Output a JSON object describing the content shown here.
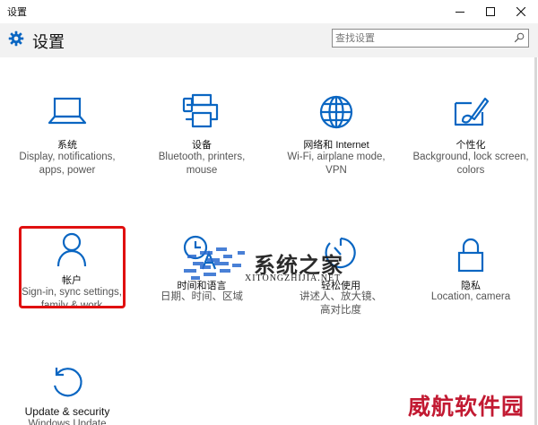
{
  "window": {
    "title": "设置",
    "controls": {
      "minimize_icon": "minimize-icon",
      "maximize_icon": "maximize-icon",
      "close_icon": "close-icon"
    }
  },
  "header": {
    "icon": "gear-icon",
    "title": "设置",
    "search": {
      "placeholder": "查找设置",
      "value": "",
      "icon": "search-icon"
    }
  },
  "tiles": [
    {
      "icon": "laptop-icon",
      "name": "系统",
      "desc": "Display, notifications, apps, power"
    },
    {
      "icon": "printer-icon",
      "name": "设备",
      "desc": "Bluetooth, printers, mouse"
    },
    {
      "icon": "globe-icon",
      "name": "网络和 Internet",
      "desc": "Wi-Fi, airplane mode, VPN"
    },
    {
      "icon": "paintbrush-icon",
      "name": "个性化",
      "desc": "Background, lock screen, colors"
    },
    {
      "icon": "person-icon",
      "name": "帐户",
      "desc": "Sign-in, sync settings, family & work",
      "highlighted": true
    },
    {
      "icon": "clock-language-icon",
      "name": "时间和语言",
      "desc": "日期、时间、区域"
    },
    {
      "icon": "accessibility-timer-icon",
      "name": "轻松使用",
      "desc": "讲述人、放大镜、高对比度"
    },
    {
      "icon": "lock-icon",
      "name": "隐私",
      "desc": "Location, camera"
    },
    {
      "icon": "update-icon",
      "name": "Update & security",
      "desc": "Windows Update"
    }
  ],
  "watermarks": {
    "site_cn": "系统之家",
    "site_en": "XITONGZHIJIA.NET",
    "bottom": "威航软件园"
  },
  "colors": {
    "accent": "#0a66c2",
    "highlight_border": "#e01010",
    "header_bg": "#f2f2f2",
    "watermark_red": "#c21a32"
  }
}
